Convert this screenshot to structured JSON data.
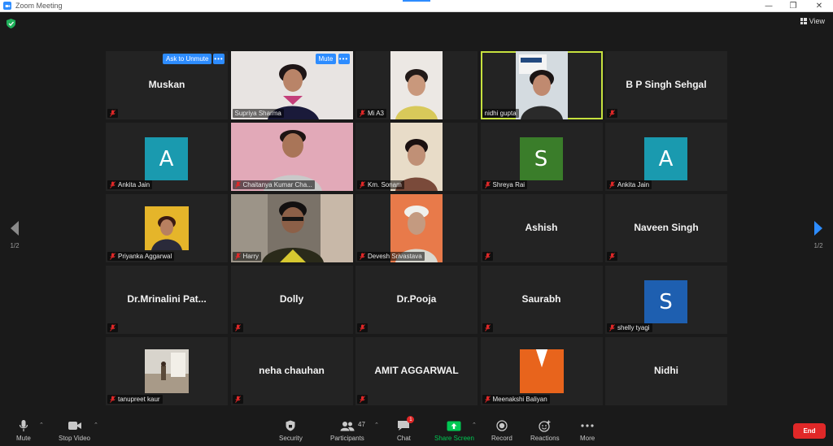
{
  "window": {
    "title": "Zoom Meeting",
    "minimize": "—",
    "restore": "❐",
    "close": "✕"
  },
  "view": {
    "label": "View"
  },
  "pager": {
    "left": "1/2",
    "right": "1/2"
  },
  "tiles": [
    {
      "name": "Muskan",
      "type": "name",
      "ask_button": "Ask to Unmute",
      "more_button": "•••"
    },
    {
      "name": "Supriya Sharma",
      "type": "video",
      "mute_button": "Mute",
      "more_button": "•••"
    },
    {
      "name": "Mi A3",
      "type": "video"
    },
    {
      "name": "nidhi gupta",
      "type": "video",
      "speaking": true
    },
    {
      "name": "B P Singh Sehgal",
      "type": "name"
    },
    {
      "name": "Ankita Jain",
      "type": "avatar",
      "initial": "A",
      "color": "#1a9aaf"
    },
    {
      "name": "Chaitanya Kumar Cha...",
      "type": "video"
    },
    {
      "name": "Km. Sonam",
      "type": "video"
    },
    {
      "name": "Shreya Rai",
      "type": "avatar",
      "initial": "S",
      "color": "#3a7d2a"
    },
    {
      "name": "Ankita Jain",
      "type": "avatar",
      "initial": "A",
      "color": "#1a9aaf"
    },
    {
      "name": "Priyanka Aggarwal",
      "type": "photo"
    },
    {
      "name": "Harry",
      "type": "video"
    },
    {
      "name": "Devesh Srivastava",
      "type": "video"
    },
    {
      "name": "Ashish",
      "type": "name"
    },
    {
      "name": "Naveen Singh",
      "type": "name"
    },
    {
      "name": "Dr.Mrinalini  Pat...",
      "type": "name"
    },
    {
      "name": "Dolly",
      "type": "name"
    },
    {
      "name": "Dr.Pooja",
      "type": "name"
    },
    {
      "name": "Saurabh",
      "type": "name"
    },
    {
      "name": "shelly tyagi",
      "type": "avatar",
      "initial": "S",
      "color": "#1e5fb0"
    },
    {
      "name": "tanupreet kaur",
      "type": "photo"
    },
    {
      "name": "neha chauhan",
      "type": "name"
    },
    {
      "name": "AMIT AGGARWAL",
      "type": "name"
    },
    {
      "name": "Meenakshi Baliyan",
      "type": "photo"
    },
    {
      "name": "Nidhi",
      "type": "name"
    }
  ],
  "toolbar": {
    "mute": "Mute",
    "stop_video": "Stop Video",
    "security": "Security",
    "participants": "Participants",
    "participants_count": "47",
    "chat": "Chat",
    "chat_badge": "1",
    "share_screen": "Share Screen",
    "record": "Record",
    "reactions": "Reactions",
    "more": "More",
    "end": "End"
  },
  "colors": {
    "accent": "#2d8cff",
    "speaking": "#c6e13e",
    "end": "#e02828",
    "share": "#00c853"
  }
}
